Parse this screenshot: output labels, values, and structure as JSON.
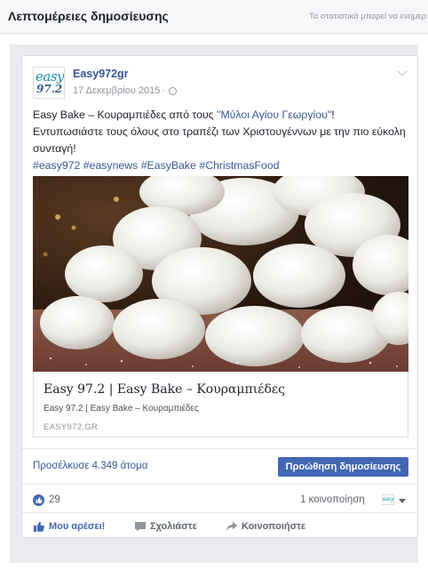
{
  "dialog": {
    "title": "Λεπτομέρειες δημοσίευσης",
    "note": "Τα στατιστικά μπορεί να ενημερ"
  },
  "post": {
    "page_name": "Easy972gr",
    "date": "17 Δεκεμβρίου 2015",
    "separator": "·",
    "avatar_logo_text_1": "easy",
    "avatar_logo_text_2": "97.2",
    "text_before_link": "Easy Bake – Κουραμπιέδες από τους ",
    "text_link": "\"Μύλοι Αγίου Γεωργίου\"",
    "text_after_link": "! Εντυπωσιάστε τους όλους στο τραπέζι των Χριστουγέννων με την πιο εύκολη συνταγή!",
    "hashtags": [
      "#easy972",
      "#easynews",
      "#EasyBake",
      "#ChristmasFood"
    ]
  },
  "link_preview": {
    "title": "Easy 97.2 | Easy Bake – Κουραμπιέδες",
    "description": "Easy 97.2 | Easy Bake – Κουραμπιέδες",
    "domain": "EASY972.GR"
  },
  "reach": {
    "label": "Προσέλκυσε 4.349 άτομα",
    "boost_button": "Προώθηση δημοσίευσης"
  },
  "stats": {
    "likes": "29",
    "shares": "1 κοινοποίηση",
    "mini_avatar_text": "easy"
  },
  "actions": {
    "like": "Μου αρέσει!",
    "comment": "Σχολιάστε",
    "share": "Κοινοποιήστε"
  },
  "colors": {
    "link_blue": "#365899",
    "button_blue": "#4267b2",
    "muted": "#90949c"
  },
  "icons": [
    "globe-icon",
    "chevron-down-icon",
    "like-icon",
    "comment-icon",
    "share-icon",
    "caret-down-icon"
  ]
}
